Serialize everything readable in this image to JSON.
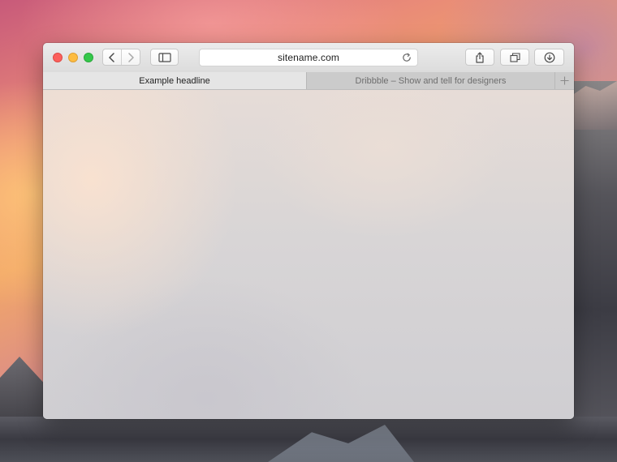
{
  "window": {
    "address": "sitename.com",
    "tabs": [
      {
        "label": "Example headline",
        "active": true
      },
      {
        "label": "Dribbble – Show and tell for designers",
        "active": false
      }
    ]
  },
  "icons": {
    "traffic_lights": [
      "close-icon",
      "minimize-icon",
      "zoom-icon"
    ],
    "toolbar": [
      "chevron-left-icon",
      "chevron-right-icon",
      "sidebar-icon",
      "reload-icon",
      "share-icon",
      "tabs-overview-icon",
      "download-icon",
      "plus-icon"
    ]
  },
  "colors": {
    "close": "#fc605c",
    "minimize": "#fdbc40",
    "zoom": "#34c84a"
  }
}
